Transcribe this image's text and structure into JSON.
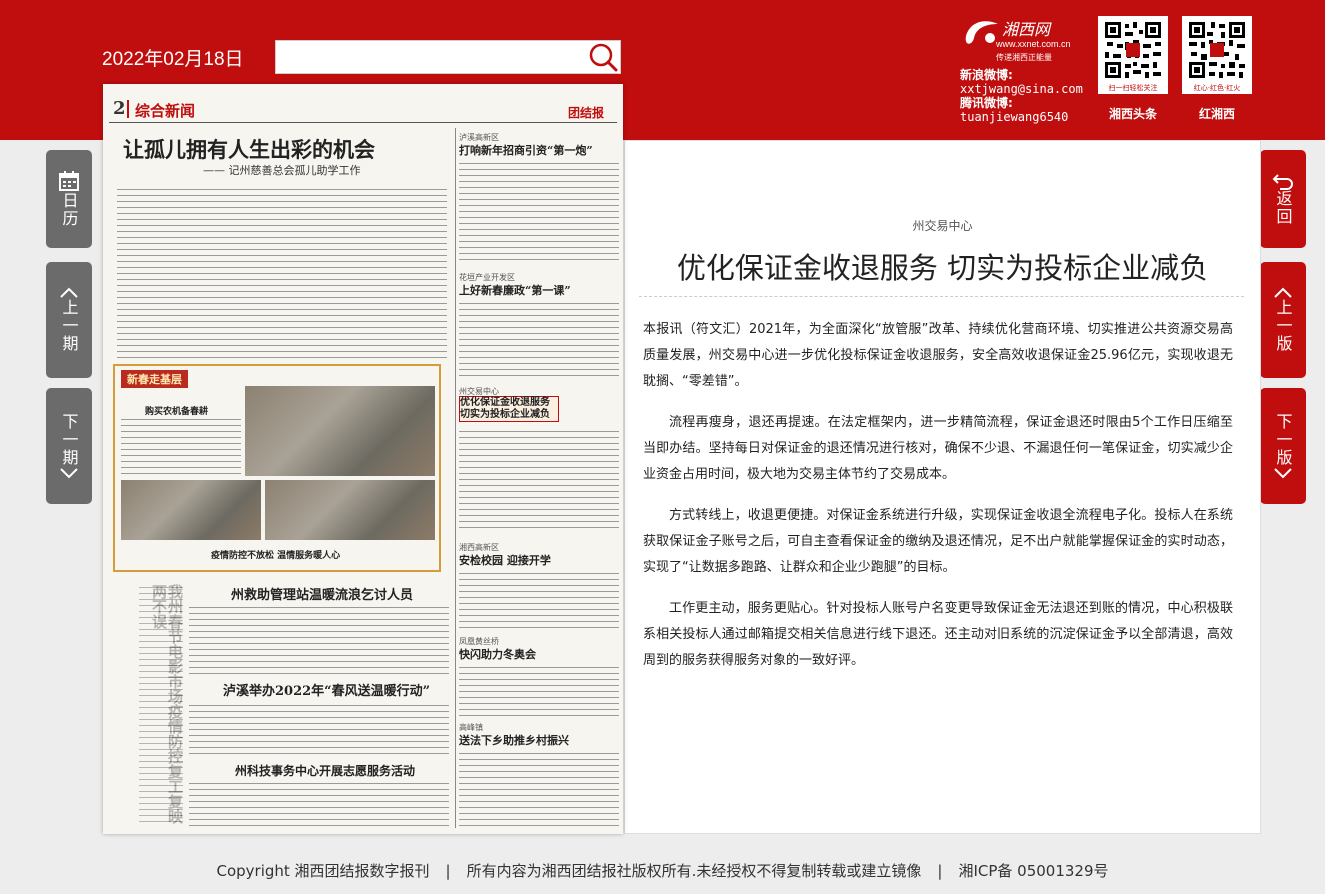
{
  "header": {
    "date": "2022年02月18日",
    "search_placeholder": "",
    "logo_name": "湘西网",
    "logo_url": "www.xxnet.com.cn",
    "logo_tagline": "传递湘西正能量",
    "weibo_sina_label": "新浪微博:",
    "weibo_sina_value": "xxtjwang@sina.com",
    "weibo_tencent_label": "腾讯微博:",
    "weibo_tencent_value": "tuanjiewang6540",
    "qr_toutiao_caption": "扫一扫轻松关注",
    "qr_toutiao_label": "湘西头条",
    "qr_hong_caption": "红心·红色·红火",
    "qr_hong_label": "红湘西",
    "accent_color": "#c00d0d"
  },
  "nav": {
    "calendar": "日历",
    "prev_issue": "上一期",
    "next_issue": "下一期",
    "back": "返回",
    "prev_page": "上一版",
    "next_page": "下一版"
  },
  "newspaper": {
    "page_no": "2",
    "section": "综合新闻",
    "masthead": "团结报",
    "lead_title": "让孤儿拥有人生出彩的机会",
    "lead_subtitle": "—— 记州慈善总会孤儿助学工作",
    "col1_kicker": "泸溪高新区",
    "col1_title": "打响新年招商引资“第一炮”",
    "col2_kicker": "花垣产业开发区",
    "col2_title": "上好新春廉政“第一课”",
    "col3_kicker": "州交易中心",
    "col3_title": "优化保证金收退服务 切实为投标企业减负",
    "feature_banner": "新春走基层",
    "feature_title": "购买农机备春耕",
    "feature_caption": "疫情防控不放松 温情服务暖人心",
    "col4_kicker": "湘西高新区",
    "col4_title": "安检校园 迎接开学",
    "col5_kicker": "凤凰黄丝桥",
    "col5_title": "快闪助力冬奥会",
    "col6_kicker": "高峰镇",
    "col6_title": "送法下乡助推乡村振兴",
    "story2_title": "州救助管理站温暖流浪乞讨人员",
    "story3_title": "泸溪举办2022年“春风送温暖行动”",
    "story4_title": "州科技事务中心开展志愿服务活动",
    "vertical_title": "我州春节电影市场疫情防控复工复映两不误"
  },
  "article": {
    "tag": "州交易中心",
    "title": "优化保证金收退服务 切实为投标企业减负",
    "paragraphs": [
      "本报讯（符文汇）2021年，为全面深化“放管服”改革、持续优化营商环境、切实推进公共资源交易高质量发展，州交易中心进一步优化投标保证金收退服务，安全高效收退保证金25.96亿元，实现收退无耽搁、“零差错”。",
      "流程再瘦身，退还再提速。在法定框架内，进一步精简流程，保证金退还时限由5个工作日压缩至当即办结。坚持每日对保证金的退还情况进行核对，确保不少退、不漏退任何一笔保证金，切实减少企业资金占用时间，极大地为交易主体节约了交易成本。",
      "方式转线上，收退更便捷。对保证金系统进行升级，实现保证金收退全流程电子化。投标人在系统获取保证金子账号之后，可自主查看保证金的缴纳及退还情况，足不出户就能掌握保证金的实时动态，实现了“让数据多跑路、让群众和企业少跑腿”的目标。",
      "工作更主动，服务更贴心。针对投标人账号户名变更导致保证金无法退还到账的情况，中心积极联系相关投标人通过邮箱提交相关信息进行线下退还。还主动对旧系统的沉淀保证金予以全部清退，高效周到的服务获得服务对象的一致好评。"
    ]
  },
  "footer": {
    "copyright": "Copyright 湘西团结报数字报刊",
    "rights": "所有内容为湘西团结报社版权所有.未经授权不得复制转载或建立镜像",
    "sep": "|",
    "icp": "湘ICP备 05001329号"
  }
}
